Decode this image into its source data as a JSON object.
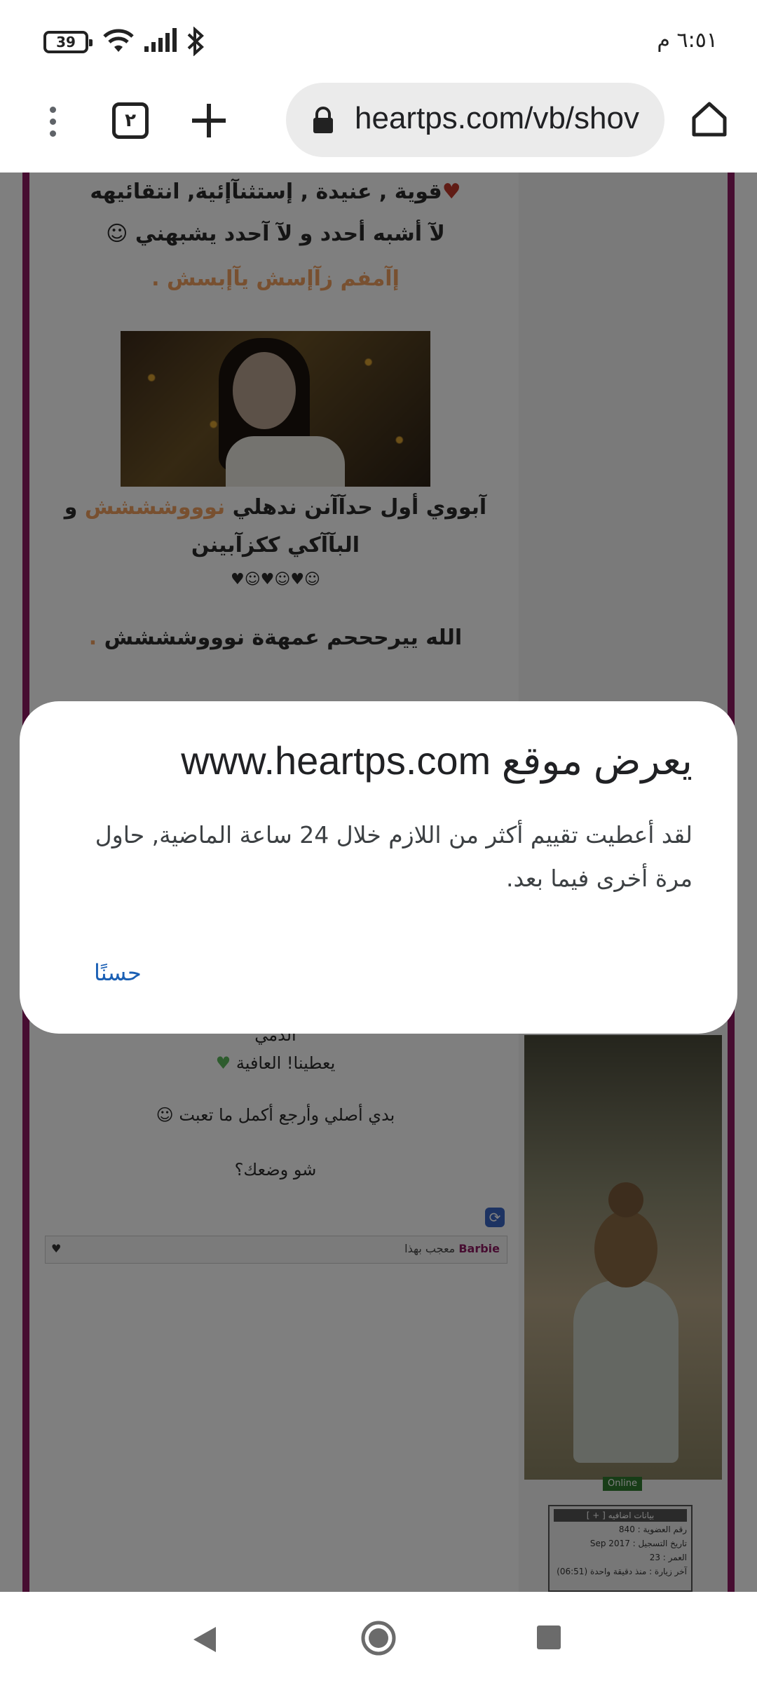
{
  "status_bar": {
    "time": "٦:٥١ م",
    "battery": "39"
  },
  "browser": {
    "url": "heartps.com/vb/shov",
    "tab_count": "٢"
  },
  "page": {
    "lines": [
      "قوية , عنيدة , إستثنآإئية, انتقائيهه",
      "لآ أشبه أحدد و لآ آحدد يشبهني",
      "إآمفم زآإسش يآإبسش .",
      "آبووي أول حدآآنن ندهلي",
      "نوووشششش",
      "و",
      "البآآكي ككزآبينن",
      "الله ييرحححم عمهةة نوووشششش",
      "الدمي",
      "يعطينا! العافية",
      "بدي أصلي وأرجع أكمل ما تعبت",
      "شو وضعك؟"
    ],
    "thanks": {
      "user": "Barbie",
      "text": "معجب بهذا"
    },
    "online_label": "Online",
    "info_box": {
      "title": "بيانات اضافيه [ + ]",
      "member_no": "رقم العضوية : 840",
      "join_date": "تاريخ التسجيل : Sep 2017",
      "age": "العمر : 23",
      "last_visit": "آخر زيارة : منذ دقيقة واحدة (06:51)"
    }
  },
  "dialog": {
    "title": "يعرض موقع www.heartps.com",
    "message": "لقد أعطيت تقييم أكثر من اللازم خلال 24 ساعة الماضية, حاول مرة أخرى فيما بعد.",
    "ok_label": "حسنًا"
  },
  "colors": {
    "frame": "#8e1a62",
    "orange_text": "#f0a060",
    "dialog_button": "#1a5fb4"
  }
}
